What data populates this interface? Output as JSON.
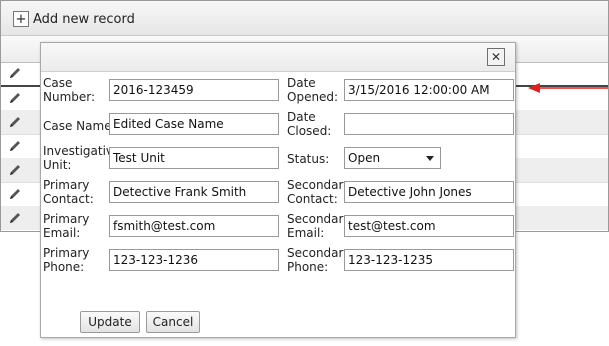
{
  "toolbar": {
    "add_label": "Add new record"
  },
  "grid": {
    "row_count": 6
  },
  "dialog": {
    "close_symbol": "✕",
    "fields": {
      "case_number": {
        "label_1": "Case",
        "label_2": "Number:",
        "value": "2016-123459"
      },
      "date_opened": {
        "label_1": "Date",
        "label_2": "Opened:",
        "value": "3/15/2016 12:00:00 AM"
      },
      "case_name": {
        "label": "Case Name:",
        "value": "Edited Case Name"
      },
      "date_closed": {
        "label_1": "Date",
        "label_2": "Closed:",
        "value": ""
      },
      "investigative_unit": {
        "label_1": "Investigative",
        "label_2": "Unit:",
        "value": "Test Unit"
      },
      "status": {
        "label": "Status:",
        "value": "Open"
      },
      "primary_contact": {
        "label_1": "Primary",
        "label_2": "Contact:",
        "value": "Detective Frank Smith"
      },
      "secondary_contact": {
        "label_1": "Secondary",
        "label_2": "Contact:",
        "value": "Detective John Jones"
      },
      "primary_email": {
        "label_1": "Primary",
        "label_2": "Email:",
        "value": "fsmith@test.com"
      },
      "secondary_email": {
        "label_1": "Secondary",
        "label_2": "Email:",
        "value": "test@test.com"
      },
      "primary_phone": {
        "label_1": "Primary",
        "label_2": "Phone:",
        "value": "123-123-1236"
      },
      "secondary_phone": {
        "label_1": "Secondary",
        "label_2": "Phone:",
        "value": "123-123-1235"
      }
    },
    "buttons": {
      "update": "Update",
      "cancel": "Cancel"
    }
  },
  "colors": {
    "annotation_arrow": "#e02020"
  }
}
